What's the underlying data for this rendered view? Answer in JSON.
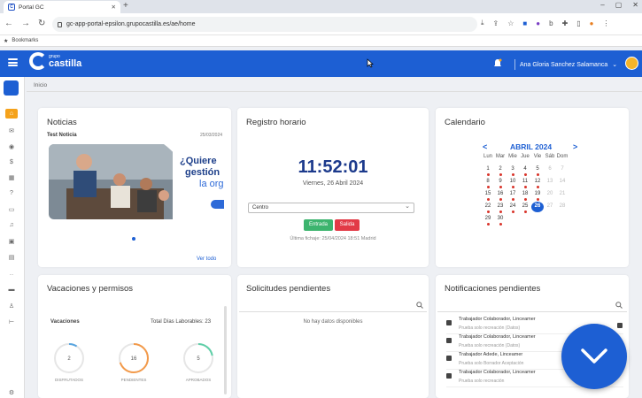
{
  "browser": {
    "tab_title": "Portal GC",
    "url": "gc-app-portal-epsilon.grupocastilla.es/ae/home",
    "bookmarks_label": "Bookmarks"
  },
  "header": {
    "logo_small": "grupo",
    "logo_big": "castilla",
    "user_name": "Ana Gloria Sanchez Salamanca"
  },
  "breadcrumb": "Inicio",
  "news": {
    "title": "Noticias",
    "item_title": "Test Noticia",
    "item_date": "25/03/2024",
    "banner_line1": "¿Quiere",
    "banner_line2": "gestión",
    "banner_line3": "la org",
    "see_all": "Ver todo"
  },
  "registro": {
    "title": "Registro horario",
    "time": "11:52:01",
    "date": "Viernes, 26 Abril 2024",
    "select_value": "Centro",
    "btn_in": "Entrada",
    "btn_out": "Salida",
    "last_sign": "Última fichaje: 25/04/2024 18:51 Madrid"
  },
  "calendar": {
    "title": "Calendario",
    "prev": "<",
    "next": ">",
    "month": "ABRIL 2024",
    "weekdays": [
      "Lun",
      "Mar",
      "Mie",
      "Jue",
      "Vie",
      "Sáb",
      "Dom"
    ],
    "weeks": [
      [
        {
          "d": "1",
          "dot": true
        },
        {
          "d": "2",
          "dot": true
        },
        {
          "d": "3",
          "dot": true
        },
        {
          "d": "4",
          "dot": true
        },
        {
          "d": "5",
          "dot": true
        },
        {
          "d": "6",
          "we": true
        },
        {
          "d": "7",
          "we": true
        }
      ],
      [
        {
          "d": "8",
          "dot": true
        },
        {
          "d": "9",
          "dot": true
        },
        {
          "d": "10",
          "dot": true
        },
        {
          "d": "11",
          "dot": true
        },
        {
          "d": "12",
          "dot": true
        },
        {
          "d": "13",
          "we": true
        },
        {
          "d": "14",
          "we": true
        }
      ],
      [
        {
          "d": "15",
          "dot": true
        },
        {
          "d": "16",
          "dot": true
        },
        {
          "d": "17",
          "dot": true
        },
        {
          "d": "18",
          "dot": true
        },
        {
          "d": "19",
          "dot": true
        },
        {
          "d": "20",
          "we": true
        },
        {
          "d": "21",
          "we": true
        }
      ],
      [
        {
          "d": "22",
          "dot": true
        },
        {
          "d": "23",
          "dot": true
        },
        {
          "d": "24",
          "dot": true
        },
        {
          "d": "25",
          "dot": true
        },
        {
          "d": "26",
          "today": true
        },
        {
          "d": "27",
          "we": true
        },
        {
          "d": "28",
          "we": true
        }
      ],
      [
        {
          "d": "29",
          "dot": true
        },
        {
          "d": "30",
          "dot": true
        },
        {
          "d": ""
        },
        {
          "d": ""
        },
        {
          "d": ""
        },
        {
          "d": ""
        },
        {
          "d": ""
        }
      ]
    ]
  },
  "vacaciones": {
    "title": "Vacaciones y permisos",
    "subtitle": "Vacaciones",
    "total_label": "Total Días Laborables: 23",
    "donuts": [
      {
        "value": "2",
        "label": "DISFRUTADOS",
        "color": "#5aa6e0",
        "fraction": 0.09
      },
      {
        "value": "16",
        "label": "PENDIENTES",
        "color": "#f39a4a",
        "fraction": 0.7
      },
      {
        "value": "5",
        "label": "APROBADOS",
        "color": "#5fcfa8",
        "fraction": 0.22
      }
    ]
  },
  "solicitudes": {
    "title": "Solicitudes pendientes",
    "empty": "No hay datos disponibles"
  },
  "notificaciones": {
    "title": "Notificaciones pendientes",
    "items": [
      {
        "title": "Trabajador Colaborador, Linceamer",
        "sub": "Prueba solo recreación (Datos)"
      },
      {
        "title": "Trabajador Colaborador, Linceamer",
        "sub": "Prueba solo recreación (Datos)"
      },
      {
        "title": "Trabajador Adede, Linceamer",
        "sub": "Prueba solo Borrador Aceptación"
      },
      {
        "title": "Trabajador Colaborador, Linceamer",
        "sub": "Prueba solo recreación"
      }
    ]
  },
  "colors": {
    "primary": "#1d5fd3",
    "accent": "#f5a21b",
    "success": "#3cb46e",
    "danger": "#e23a46"
  }
}
